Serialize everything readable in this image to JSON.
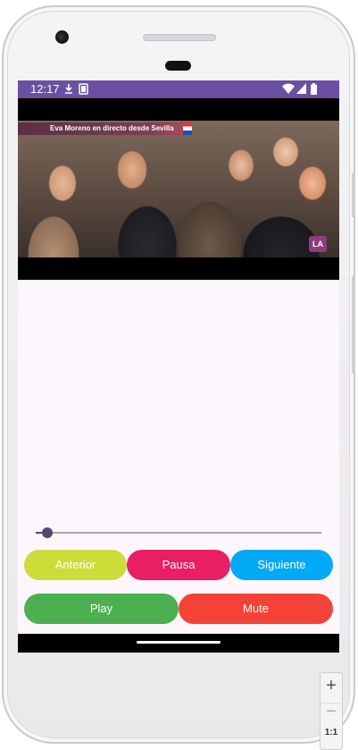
{
  "statusbar": {
    "time": "12:17",
    "bg_color": "#6a4fa3",
    "left_icons": [
      "download-icon",
      "screenshot-icon"
    ],
    "right_icons": [
      "wifi-icon",
      "signal-icon",
      "battery-icon"
    ]
  },
  "video": {
    "caption": "Eva Moreno en directo desde Sevilla",
    "logo_text": "LA"
  },
  "seekbar": {
    "progress": 0.04
  },
  "controls": {
    "prev_label": "Anterior",
    "pause_label": "Pausa",
    "next_label": "Siguiente",
    "play_label": "Play",
    "mute_label": "Mute",
    "colors": {
      "prev": "#cddc39",
      "pause": "#e91e63",
      "next": "#03a9f4",
      "play": "#4caf50",
      "mute": "#f44336"
    }
  },
  "zoom": {
    "in_label": "+",
    "out_label": "−",
    "ratio_label": "1:1"
  }
}
